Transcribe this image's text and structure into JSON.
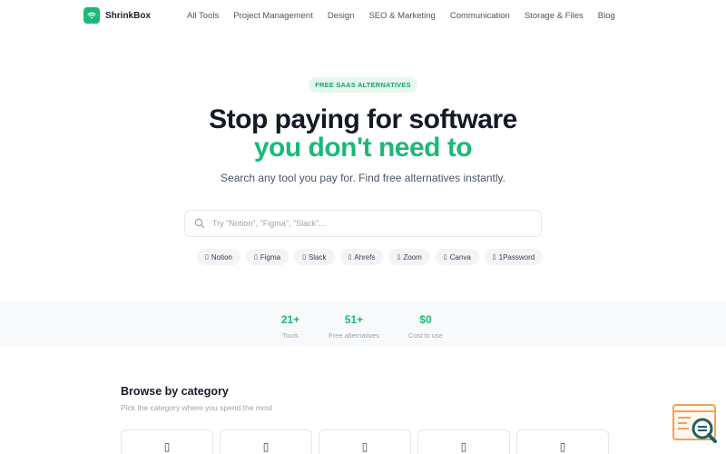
{
  "brand": {
    "name": "ShrinkBox",
    "logo_icon": "wifi-icon",
    "accent": "#1db877"
  },
  "nav": {
    "links": [
      "All Tools",
      "Project Management",
      "Design",
      "SEO & Marketing",
      "Communication",
      "Storage & Files",
      "Blog"
    ]
  },
  "hero": {
    "badge": "FREE SAAS ALTERNATIVES",
    "title_line1": "Stop paying for software",
    "title_line2": "you don't need to",
    "subtitle": "Search any tool you pay for. Find free alternatives instantly."
  },
  "search": {
    "placeholder": "Try \"Notion\", \"Figma\", \"Slack\"...",
    "value": "",
    "icon": "search-icon"
  },
  "quick_chips": {
    "glyph": "▯",
    "items": [
      "Notion",
      "Figma",
      "Slack",
      "Ahrefs",
      "Zoom",
      "Canva",
      "1Password"
    ]
  },
  "stats": [
    {
      "value": "21+",
      "label": "Tools"
    },
    {
      "value": "51+",
      "label": "Free alternatives"
    },
    {
      "value": "$0",
      "label": "Cost to use"
    }
  ],
  "categories": {
    "title": "Browse by category",
    "subtitle": "Pick the category where you spend the most",
    "card_glyph": "▯",
    "card_count": 5
  },
  "colors": {
    "accent": "#1db877",
    "badge_bg": "#e6f7ef",
    "widget_orange": "#f0a35a",
    "widget_teal": "#1f5e66"
  }
}
